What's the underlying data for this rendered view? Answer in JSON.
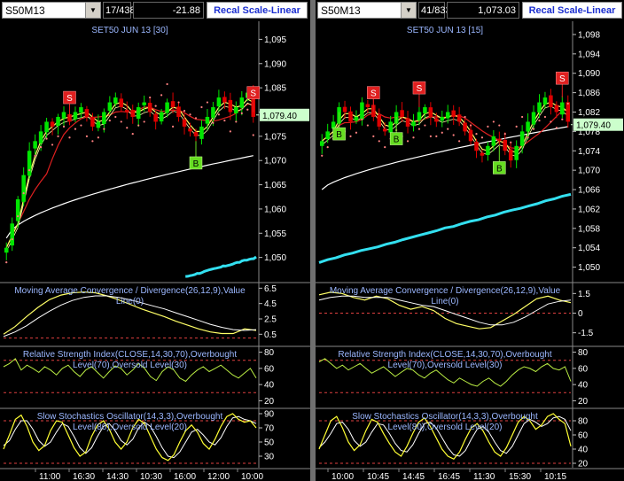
{
  "colors": {
    "background": "#000000",
    "up_candle": "#00e600",
    "down_candle": "#e00000",
    "sma_fast": "#ffff66",
    "sma_mid": "#e02020",
    "sma_slow": "#ffffff",
    "long_term": "#33e0f0",
    "sar": "#ff8080",
    "buy_marker": "#66dd22",
    "sell_marker": "#e02020",
    "price_tag": "#ccffcc",
    "indicator_title": "#9bb7ff",
    "level_line": "#e04040"
  },
  "chart_data": [
    {
      "type": "candlestick",
      "symbol": "S50M13",
      "title": "SET50 JUN 13   [30]",
      "bar_count": "17/438",
      "change": "-21.88",
      "scale_button": "Recal Scale-Linear",
      "last_price": "1,079.40",
      "last_value": 1079.4,
      "ylim": [
        1045,
        1098
      ],
      "y_ticks": [
        "1,095",
        "1,090",
        "1,085",
        "1,080",
        "1,075",
        "1,070",
        "1,065",
        "1,060",
        "1,055",
        "1,050"
      ],
      "y_tick_values": [
        1095,
        1090,
        1085,
        1080,
        1075,
        1070,
        1065,
        1060,
        1055,
        1050
      ],
      "x_time_labels": [
        "11:00",
        "16:30",
        "14:30",
        "10:30",
        "16:00",
        "12:00",
        "10:00"
      ],
      "closes": [
        1052,
        1057,
        1062,
        1067,
        1072,
        1074,
        1076,
        1078,
        1077,
        1079,
        1080,
        1078,
        1080,
        1081,
        1079,
        1077,
        1078,
        1080,
        1082,
        1083,
        1081,
        1080,
        1079,
        1081,
        1082,
        1080,
        1078,
        1080,
        1082,
        1081,
        1079,
        1077,
        1076,
        1075,
        1077,
        1079,
        1081,
        1083,
        1082,
        1080,
        1081,
        1083,
        1084,
        1079
      ],
      "buy_signals": [
        {
          "index": 33,
          "label": "B"
        }
      ],
      "sell_signals": [
        {
          "index": 11,
          "label": "S"
        },
        {
          "index": 43,
          "label": "S"
        }
      ],
      "long_term_range": [
        1046,
        1050
      ],
      "indicators": [
        {
          "name": "Moving Average Convergence / Divergence(26,12,9),Value Line(0)",
          "y_ticks": [
            "6.5",
            "4.5",
            "2.5",
            "0.5"
          ],
          "y_tick_values": [
            6.5,
            4.5,
            2.5,
            0.5
          ],
          "ylim": [
            -0.5,
            7
          ],
          "levels": [
            0
          ],
          "macd": [
            0.5,
            1.5,
            2.8,
            4.0,
            5.0,
            5.6,
            5.9,
            6.0,
            5.9,
            5.5,
            5.0,
            4.4,
            3.8,
            3.3,
            2.8,
            2.2,
            1.7,
            1.2,
            0.8,
            0.6,
            0.6,
            1.2,
            1.0
          ],
          "signal": [
            0.2,
            0.8,
            1.6,
            2.6,
            3.5,
            4.3,
            4.9,
            5.3,
            5.5,
            5.5,
            5.3,
            5.0,
            4.6,
            4.2,
            3.8,
            3.3,
            2.8,
            2.3,
            1.8,
            1.4,
            1.1,
            1.0,
            1.1
          ]
        },
        {
          "name": "Relative Strength Index(CLOSE,14,30,70),Overbought Level(70),Oversold Level(30)",
          "y_ticks": [
            "80",
            "60",
            "40",
            "20"
          ],
          "y_tick_values": [
            80,
            60,
            40,
            20
          ],
          "ylim": [
            15,
            85
          ],
          "levels": [
            70,
            30
          ],
          "values": [
            62,
            66,
            72,
            58,
            64,
            60,
            55,
            62,
            58,
            52,
            60,
            64,
            56,
            50,
            58,
            62,
            55,
            48,
            56,
            63,
            60,
            52,
            58,
            66,
            60,
            50,
            45,
            56,
            62,
            58,
            48,
            44,
            52,
            58,
            62,
            56,
            60,
            64,
            58,
            52,
            48,
            54,
            60,
            48
          ]
        },
        {
          "name": "Slow Stochastics Oscillator(14,3,3),Overbought Level(80),Oversold Level(20)",
          "y_ticks": [
            "90",
            "70",
            "50",
            "30"
          ],
          "y_tick_values": [
            90,
            70,
            50,
            30
          ],
          "ylim": [
            15,
            95
          ],
          "levels": [
            80,
            20
          ],
          "k": [
            40,
            60,
            82,
            88,
            72,
            50,
            38,
            45,
            66,
            80,
            78,
            60,
            42,
            30,
            36,
            58,
            74,
            80,
            68,
            50,
            40,
            50,
            70,
            82,
            76,
            58,
            40,
            28,
            24,
            32,
            50,
            66,
            74,
            64,
            48,
            40,
            54,
            72,
            86,
            90,
            82,
            78,
            80,
            70
          ],
          "d": [
            45,
            52,
            68,
            80,
            80,
            68,
            52,
            44,
            50,
            64,
            76,
            72,
            58,
            42,
            34,
            42,
            58,
            72,
            76,
            66,
            52,
            46,
            54,
            70,
            78,
            72,
            58,
            42,
            30,
            28,
            36,
            50,
            64,
            68,
            60,
            50,
            46,
            56,
            72,
            84,
            86,
            82,
            80,
            76
          ]
        }
      ]
    },
    {
      "type": "candlestick",
      "symbol": "S50M13",
      "title": "SET50 JUN 13   [15]",
      "bar_count": "41/833",
      "change": "1,073.03",
      "scale_button": "Recal Scale-Linear",
      "last_price": "1,079.40",
      "last_value": 1079.4,
      "ylim": [
        1047,
        1100
      ],
      "y_ticks": [
        "1,098",
        "1,094",
        "1,090",
        "1,086",
        "1,082",
        "1,078",
        "1,074",
        "1,070",
        "1,066",
        "1,062",
        "1,058",
        "1,054",
        "1,050"
      ],
      "y_tick_values": [
        1098,
        1094,
        1090,
        1086,
        1082,
        1078,
        1074,
        1070,
        1066,
        1062,
        1058,
        1054,
        1050
      ],
      "x_time_labels": [
        "10:00",
        "10:45",
        "14:45",
        "16:45",
        "11:30",
        "15:30",
        "10:15"
      ],
      "closes": [
        1076,
        1078,
        1080,
        1083,
        1082,
        1080,
        1081,
        1084,
        1083,
        1081,
        1079,
        1078,
        1080,
        1082,
        1081,
        1079,
        1080,
        1082,
        1083,
        1081,
        1080,
        1081,
        1082,
        1081,
        1080,
        1078,
        1076,
        1074,
        1073,
        1075,
        1077,
        1076,
        1074,
        1072,
        1075,
        1078,
        1080,
        1082,
        1084,
        1085,
        1083,
        1082,
        1084,
        1080
      ],
      "buy_signals": [
        {
          "index": 3,
          "label": "B"
        },
        {
          "index": 13,
          "label": "B"
        },
        {
          "index": 31,
          "label": "B"
        }
      ],
      "sell_signals": [
        {
          "index": 9,
          "label": "S"
        },
        {
          "index": 17,
          "label": "S"
        },
        {
          "index": 42,
          "label": "S"
        }
      ],
      "long_term_range": [
        1051,
        1065
      ],
      "indicators": [
        {
          "name": "Moving Average Convergence / Divergence(26,12,9),Value Line(0)",
          "y_ticks": [
            "1.5",
            "0",
            "-1.5"
          ],
          "y_tick_values": [
            1.5,
            0,
            -1.5
          ],
          "ylim": [
            -2.2,
            2.2
          ],
          "levels": [
            0
          ],
          "macd": [
            1.4,
            1.6,
            1.5,
            1.2,
            1.0,
            1.3,
            1.1,
            0.6,
            0.3,
            0.5,
            0.2,
            -0.4,
            -0.8,
            -1.0,
            -1.2,
            -1.1,
            -0.6,
            -0.1,
            0.5,
            1.1,
            1.3,
            1.0,
            0.8
          ],
          "signal": [
            1.0,
            1.2,
            1.3,
            1.3,
            1.2,
            1.2,
            1.2,
            1.0,
            0.8,
            0.6,
            0.5,
            0.2,
            -0.1,
            -0.4,
            -0.7,
            -0.9,
            -0.9,
            -0.7,
            -0.3,
            0.2,
            0.7,
            0.9,
            1.0
          ]
        },
        {
          "name": "Relative Strength Index(CLOSE,14,30,70),Overbought Level(70),Oversold Level(30)",
          "y_ticks": [
            "80",
            "60",
            "40",
            "20"
          ],
          "y_tick_values": [
            80,
            60,
            40,
            20
          ],
          "ylim": [
            15,
            85
          ],
          "levels": [
            70,
            30
          ],
          "values": [
            68,
            72,
            66,
            60,
            64,
            58,
            62,
            66,
            60,
            54,
            58,
            62,
            56,
            50,
            55,
            60,
            58,
            52,
            48,
            54,
            58,
            52,
            46,
            42,
            48,
            44,
            40,
            38,
            44,
            48,
            42,
            38,
            44,
            52,
            58,
            62,
            60,
            56,
            62,
            66,
            60,
            58,
            62,
            44
          ]
        },
        {
          "name": "Slow Stochastics Oscillator(14,3,3),Overbought Level(80),Oversold Level(20)",
          "y_ticks": [
            "80",
            "60",
            "40",
            "20"
          ],
          "y_tick_values": [
            80,
            60,
            40,
            20
          ],
          "ylim": [
            15,
            95
          ],
          "levels": [
            80,
            20
          ],
          "k": [
            40,
            60,
            80,
            86,
            70,
            50,
            38,
            46,
            66,
            82,
            78,
            62,
            48,
            36,
            30,
            44,
            62,
            78,
            84,
            72,
            56,
            40,
            30,
            26,
            36,
            54,
            70,
            76,
            66,
            50,
            36,
            30,
            42,
            60,
            78,
            86,
            80,
            68,
            74,
            86,
            90,
            82,
            76,
            44
          ],
          "d": [
            42,
            50,
            62,
            76,
            78,
            68,
            52,
            44,
            50,
            64,
            76,
            74,
            62,
            48,
            38,
            36,
            46,
            62,
            76,
            78,
            70,
            56,
            42,
            32,
            30,
            38,
            54,
            68,
            72,
            64,
            50,
            38,
            34,
            44,
            60,
            76,
            82,
            78,
            72,
            76,
            84,
            86,
            82,
            66
          ]
        }
      ]
    }
  ]
}
